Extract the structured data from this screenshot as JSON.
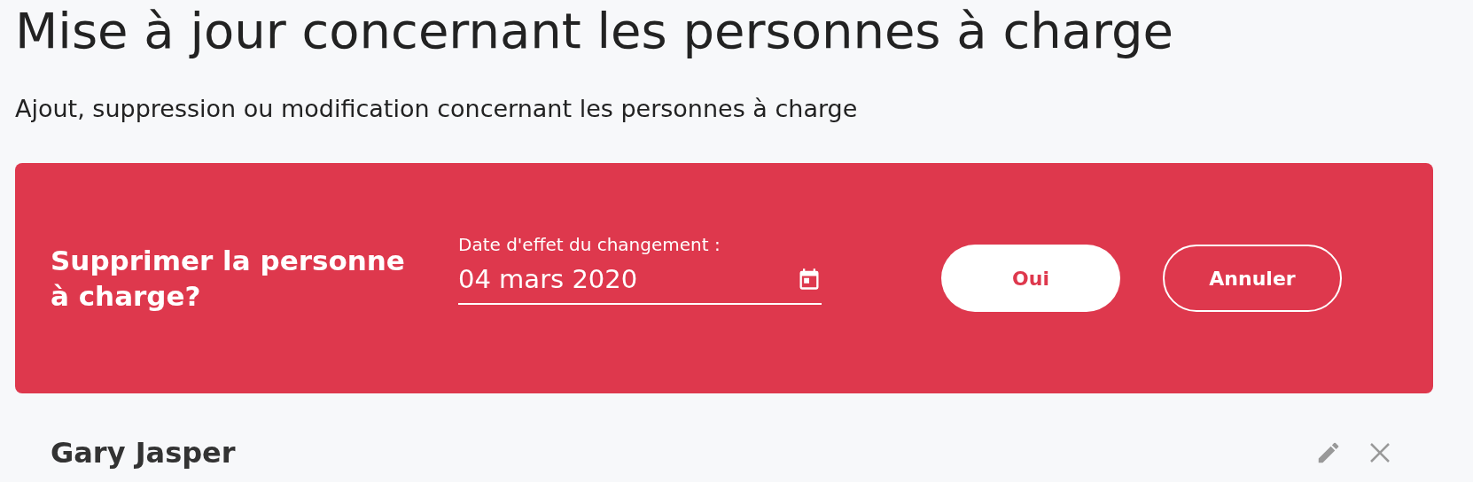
{
  "title": "Mise à jour concernant les personnes à charge",
  "subtitle": "Ajout, suppression ou modification concernant les personnes à charge",
  "confirm_panel": {
    "question": "Supprimer la personne à charge?",
    "date_field": {
      "label": "Date d'effet du changement :",
      "value": "04 mars 2020"
    },
    "buttons": [
      {
        "label": "Oui",
        "kind": "primary"
      },
      {
        "label": "Annuler",
        "kind": "outline"
      }
    ]
  },
  "dependents": [
    {
      "name": "Gary Jasper"
    }
  ]
}
